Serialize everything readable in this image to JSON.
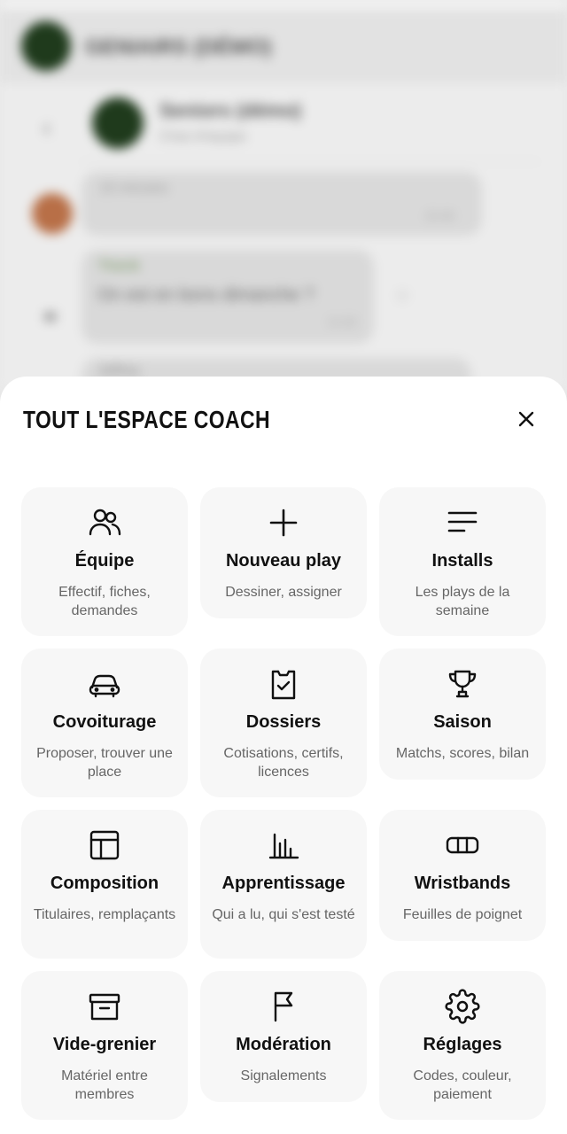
{
  "background_chat": {
    "header_title": "GENIAIRS (DÉMO)",
    "back_icon": "chevron-left-icon",
    "conversation_title": "Seniors (démo)",
    "conversation_subtitle": "Chat d'équipe",
    "message1_text": "10 minutes",
    "message1_time": "20:48",
    "initials": "M",
    "message2_author": "Thierik",
    "message2_text": "On est en bons dimanche ?",
    "message2_time": "21:00",
    "message3_text": "Jeffrey"
  },
  "sheet": {
    "title": "TOUT L'ESPACE COACH",
    "close_icon": "close-icon",
    "items": [
      {
        "label": "Équipe",
        "desc": "Effectif, fiches, demandes",
        "icon": "users-icon"
      },
      {
        "label": "Nouveau play",
        "desc": "Dessiner, assigner",
        "icon": "plus-icon"
      },
      {
        "label": "Installs",
        "desc": "Les plays de la semaine",
        "icon": "lines-icon"
      },
      {
        "label": "Covoiturage",
        "desc": "Proposer, trouver une place",
        "icon": "car-icon"
      },
      {
        "label": "Dossiers",
        "desc": "Cotisations, certifs, licences",
        "icon": "clipboard-check-icon"
      },
      {
        "label": "Saison",
        "desc": "Matchs, scores, bilan",
        "icon": "trophy-icon"
      },
      {
        "label": "Composition",
        "desc": "Titulaires, remplaçants",
        "icon": "layout-icon"
      },
      {
        "label": "Apprentissage",
        "desc": "Qui a lu, qui s'est testé",
        "icon": "bar-chart-icon"
      },
      {
        "label": "Wristbands",
        "desc": "Feuilles de poignet",
        "icon": "wristband-icon"
      },
      {
        "label": "Vide-grenier",
        "desc": "Matériel entre membres",
        "icon": "archive-icon"
      },
      {
        "label": "Modération",
        "desc": "Signalements",
        "icon": "flag-icon"
      },
      {
        "label": "Réglages",
        "desc": "Codes, couleur, paiement",
        "icon": "gear-icon"
      }
    ]
  },
  "colors": {
    "sheet_bg": "#ffffff",
    "card_bg": "#f7f7f7",
    "text_primary": "#111111",
    "text_secondary": "#666666"
  }
}
